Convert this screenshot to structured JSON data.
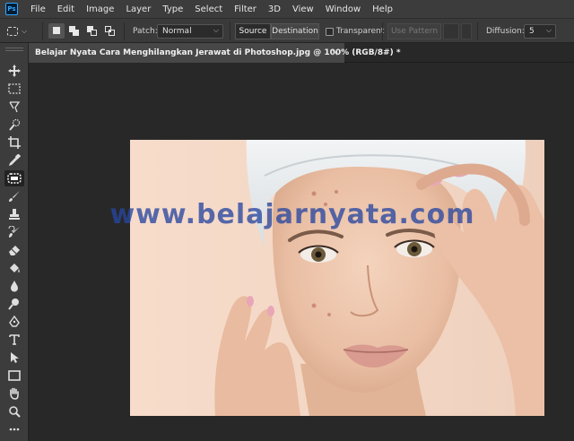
{
  "app": {
    "logo": "Ps"
  },
  "menu": [
    "File",
    "Edit",
    "Image",
    "Layer",
    "Type",
    "Select",
    "Filter",
    "3D",
    "View",
    "Window",
    "Help"
  ],
  "options": {
    "tool_icon": "patch-tool-icon",
    "patch_label": "Patch:",
    "patch_value": "Normal",
    "source_label": "Source",
    "destination_label": "Destination",
    "transparent_label": "Transparent",
    "transparent_checked": false,
    "use_pattern_label": "Use Pattern",
    "diffusion_label": "Diffusion:",
    "diffusion_value": "5"
  },
  "document": {
    "tab_title": "Belajar Nyata Cara Menghilangkan Jerawat di Photoshop.jpg @ 100% (RGB/8#) *",
    "close_icon": "×"
  },
  "canvas": {
    "watermark": "www.belajarnyata.com"
  },
  "tools": [
    "move-tool-icon",
    "marquee-tool-icon",
    "lasso-tool-icon",
    "quick-select-tool-icon",
    "crop-tool-icon",
    "eyedropper-tool-icon",
    "patch-tool-icon",
    "brush-tool-icon",
    "clone-stamp-tool-icon",
    "history-brush-tool-icon",
    "eraser-tool-icon",
    "paint-bucket-tool-icon",
    "blur-tool-icon",
    "dodge-tool-icon",
    "pen-tool-icon",
    "type-tool-icon",
    "path-select-tool-icon",
    "rectangle-tool-icon",
    "hand-tool-icon",
    "zoom-tool-icon",
    "more-tools-icon"
  ],
  "colors": {
    "menubar": "#3c3c3c",
    "workspace": "#282828",
    "accent": "#31a8ff",
    "watermark": "#2846a0"
  }
}
